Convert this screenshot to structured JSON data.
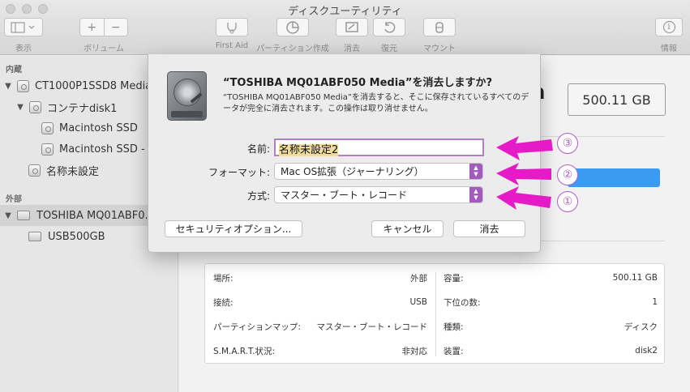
{
  "window": {
    "title": "ディスクユーティリティ"
  },
  "toolbar": {
    "view_label": "表示",
    "volume_label": "ボリューム",
    "volume_add": "+",
    "volume_remove": "−",
    "first_aid_label": "First Aid",
    "partition_label": "パーティション作成",
    "erase_label": "消去",
    "restore_label": "復元",
    "mount_label": "マウント",
    "info_label": "情報",
    "info_glyph": "i"
  },
  "sidebar": {
    "internal_header": "内蔵",
    "external_header": "外部",
    "items": [
      {
        "label": "CT1000P1SSD8 Media",
        "expand": "▼"
      },
      {
        "label": "コンテナdisk1",
        "expand": "▼"
      },
      {
        "label": "Macintosh SSD"
      },
      {
        "label": "Macintosh SSD - D"
      },
      {
        "label": "名称未設定"
      },
      {
        "label": "TOSHIBA MQ01ABF0...",
        "expand": "▼"
      },
      {
        "label": "USB500GB"
      }
    ]
  },
  "main": {
    "big_letter": "a",
    "capacity": "500.11 GB",
    "info_left": [
      {
        "key": "場所:",
        "value": "外部"
      },
      {
        "key": "接続:",
        "value": "USB"
      },
      {
        "key": "パーティションマップ:",
        "value": "マスター・ブート・レコード"
      },
      {
        "key": "S.M.A.R.T.状況:",
        "value": "非対応"
      }
    ],
    "info_right": [
      {
        "key": "容量:",
        "value": "500.11 GB"
      },
      {
        "key": "下位の数:",
        "value": "1"
      },
      {
        "key": "種類:",
        "value": "ディスク"
      },
      {
        "key": "装置:",
        "value": "disk2"
      }
    ]
  },
  "dialog": {
    "title": "“TOSHIBA MQ01ABF050 Media”を消去しますか?",
    "message": "“TOSHIBA MQ01ABF050 Media”を消去すると、そこに保存されているすべてのデータが完全に消去されます。この操作は取り消せません。",
    "name_label": "名前:",
    "name_value": "名称未設定2",
    "format_label": "フォーマット:",
    "format_value": "Mac OS拡張（ジャーナリング）",
    "scheme_label": "方式:",
    "scheme_value": "マスター・ブート・レコード",
    "security_button": "セキュリティオプション...",
    "cancel_button": "キャンセル",
    "erase_button": "消去"
  },
  "annotations": {
    "color": "#e61bc8",
    "marks": [
      "③",
      "②",
      "①"
    ]
  }
}
